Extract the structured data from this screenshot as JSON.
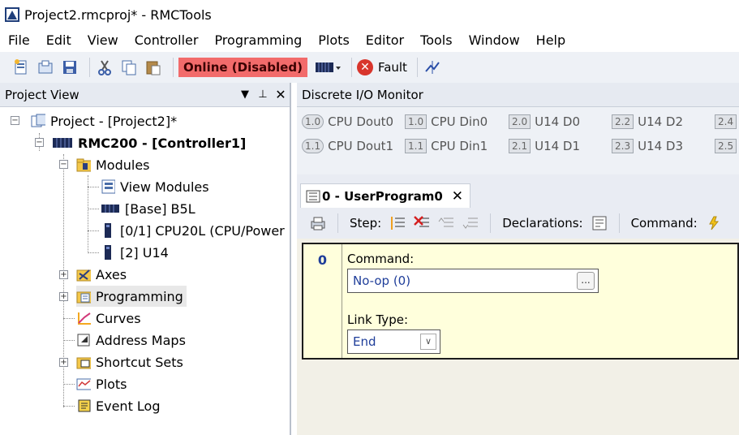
{
  "window": {
    "title": "Project2.rmcproj* - RMCTools"
  },
  "menu": [
    "File",
    "Edit",
    "View",
    "Controller",
    "Programming",
    "Plots",
    "Editor",
    "Tools",
    "Window",
    "Help"
  ],
  "toolbar": {
    "status": "Online (Disabled)",
    "fault_label": "Fault",
    "status_color": "#f26b6b"
  },
  "project_view": {
    "title": "Project View",
    "tree": {
      "project": "Project - [Project2]*",
      "controller": "RMC200 - [Controller1]",
      "modules": "Modules",
      "module_children": [
        "View Modules",
        "[Base] B5L",
        "[0/1] CPU20L (CPU/Power",
        "[2] U14"
      ],
      "axes": "Axes",
      "programming": "Programming",
      "curves": "Curves",
      "address_maps": "Address Maps",
      "shortcut_sets": "Shortcut Sets",
      "plots": "Plots",
      "event_log": "Event Log"
    }
  },
  "io_monitor": {
    "title": "Discrete I/O Monitor",
    "row1": [
      {
        "chip": "1.0",
        "label": "CPU Dout0",
        "round": true
      },
      {
        "chip": "1.0",
        "label": "CPU Din0",
        "round": false
      },
      {
        "chip": "2.0",
        "label": "U14 D0",
        "round": false
      },
      {
        "chip": "2.2",
        "label": "U14 D2",
        "round": false
      },
      {
        "chip": "2.4",
        "label": "",
        "round": false
      }
    ],
    "row2": [
      {
        "chip": "1.1",
        "label": "CPU Dout1",
        "round": true
      },
      {
        "chip": "1.1",
        "label": "CPU Din1",
        "round": false
      },
      {
        "chip": "2.1",
        "label": "U14 D1",
        "round": false
      },
      {
        "chip": "2.3",
        "label": "U14 D3",
        "round": false
      },
      {
        "chip": "2.5",
        "label": "",
        "round": false
      }
    ]
  },
  "editor": {
    "tab_label": "0 - UserProgram0",
    "toolbar": {
      "step": "Step:",
      "declarations": "Declarations:",
      "command": "Command:"
    },
    "step": {
      "number": "0",
      "command_label": "Command:",
      "command_value": "No-op (0)",
      "browse": "...",
      "link_type_label": "Link Type:",
      "link_type_value": "End"
    }
  }
}
